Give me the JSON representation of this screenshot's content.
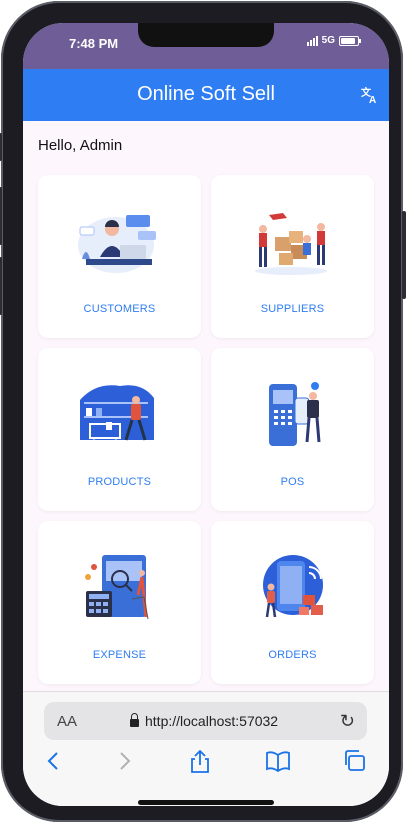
{
  "status": {
    "time": "7:48 PM",
    "network": "5G"
  },
  "app": {
    "title": "Online Soft Sell"
  },
  "greeting": "Hello, Admin",
  "tiles": [
    {
      "label": "CUSTOMERS"
    },
    {
      "label": "SUPPLIERS"
    },
    {
      "label": "PRODUCTS"
    },
    {
      "label": "POS"
    },
    {
      "label": "EXPENSE"
    },
    {
      "label": "ORDERS"
    }
  ],
  "browser": {
    "text_size_label": "AA",
    "url": "http://localhost:57032"
  },
  "colors": {
    "primary": "#2f7df2",
    "statusbar": "#6e5d96",
    "background": "#fdf7fd"
  }
}
